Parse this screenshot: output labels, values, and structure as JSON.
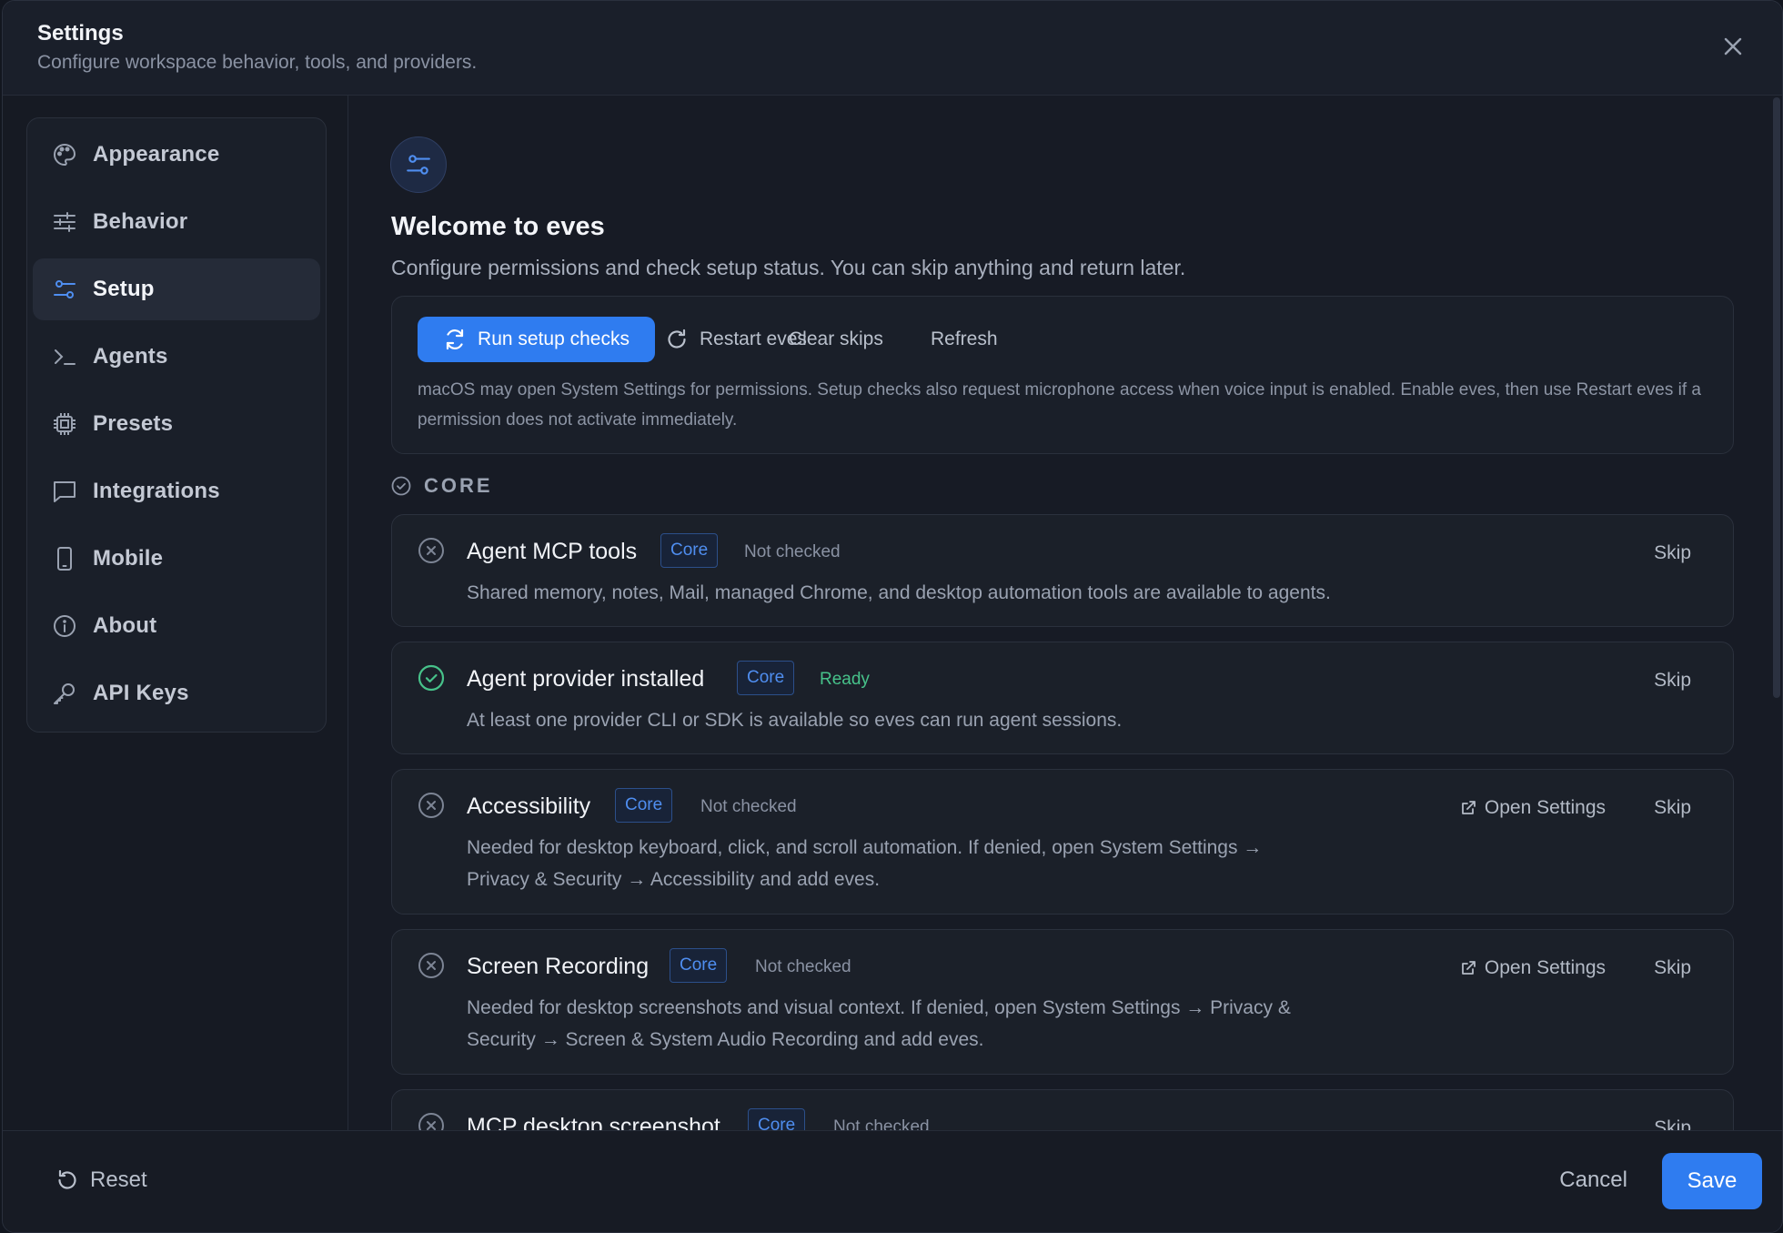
{
  "header": {
    "title": "Settings",
    "subtitle": "Configure workspace behavior, tools, and providers."
  },
  "sidebar": {
    "items": [
      {
        "label": "Appearance",
        "icon": "palette-icon"
      },
      {
        "label": "Behavior",
        "icon": "sliders-icon"
      },
      {
        "label": "Setup",
        "icon": "setup-sliders-icon",
        "active": true
      },
      {
        "label": "Agents",
        "icon": "terminal-icon"
      },
      {
        "label": "Presets",
        "icon": "chip-icon"
      },
      {
        "label": "Integrations",
        "icon": "chat-icon"
      },
      {
        "label": "Mobile",
        "icon": "phone-icon"
      },
      {
        "label": "About",
        "icon": "info-icon"
      },
      {
        "label": "API Keys",
        "icon": "key-icon"
      }
    ]
  },
  "setup": {
    "title": "Welcome to eves",
    "subtitle": "Configure permissions and check setup status. You can skip anything and return later.",
    "actions": {
      "run": "Run setup checks",
      "restart": "Restart eves",
      "clear": "Clear skips",
      "refresh": "Refresh"
    },
    "note": "macOS may open System Settings for permissions. Setup checks also request microphone access when voice input is enabled. Enable eves, then use Restart eves if a permission does not activate immediately.",
    "section_label": "CORE",
    "cards": [
      {
        "title": "Agent MCP tools",
        "badge": "Core",
        "status": "Not checked",
        "desc1": "Shared memory, notes, Mail, managed Chrome, and desktop automation tools are available to agents.",
        "desc2": "",
        "skip": "Skip",
        "open_settings": ""
      },
      {
        "title": "Agent provider installed",
        "badge": "Core",
        "status": "Ready",
        "desc1": "At least one provider CLI or SDK is available so eves can run agent sessions.",
        "desc2": "",
        "skip": "Skip",
        "open_settings": ""
      },
      {
        "title": "Accessibility",
        "badge": "Core",
        "status": "Not checked",
        "desc1": "Needed for desktop keyboard, click, and scroll automation. If denied, open System Settings →",
        "desc2": "Privacy & Security → Accessibility and add eves.",
        "skip": "Skip",
        "open_settings": "Open Settings"
      },
      {
        "title": "Screen Recording",
        "badge": "Core",
        "status": "Not checked",
        "desc1": "Needed for desktop screenshots and visual context. If denied, open System Settings → Privacy &",
        "desc2": "Security → Screen & System Audio Recording and add eves.",
        "skip": "Skip",
        "open_settings": "Open Settings"
      },
      {
        "title": "MCP desktop screenshot",
        "badge": "Core",
        "status": "Not checked",
        "desc1": "",
        "desc2": "",
        "skip": "Skip",
        "open_settings": ""
      }
    ]
  },
  "footer": {
    "reset": "Reset",
    "cancel": "Cancel",
    "save": "Save"
  },
  "colors": {
    "accent": "#2f7cf0",
    "ready": "#47c28a",
    "background": "#171b25"
  }
}
